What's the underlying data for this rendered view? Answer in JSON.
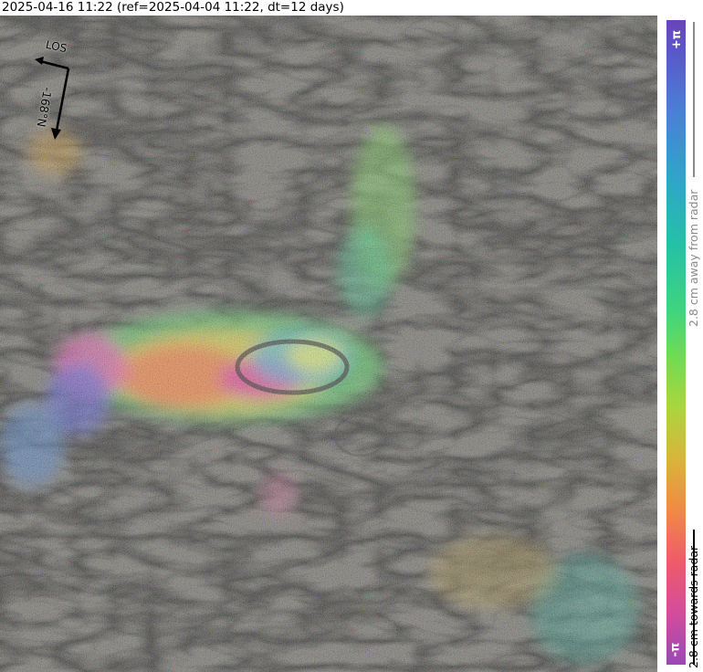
{
  "title": "2025-04-16 11:22 (ref=2025-04-04 11:22, dt=12 days)",
  "map": {
    "los_label": "LOS",
    "heading_label": "-168°N",
    "layers": [
      "hillshade",
      "wrapped-phase-interferogram"
    ]
  },
  "colorbar": {
    "top_label": "+π",
    "bottom_label": "-π",
    "away_text": "2.8 cm away from radar",
    "towards_text": "2.8 cm towards radar",
    "colors": [
      "#6a44b8",
      "#4a7fd6",
      "#23c2a6",
      "#3fd480",
      "#a9d63d",
      "#d9b53a",
      "#f08a45",
      "#f05a6a",
      "#d44c9c",
      "#9a48b6"
    ]
  }
}
